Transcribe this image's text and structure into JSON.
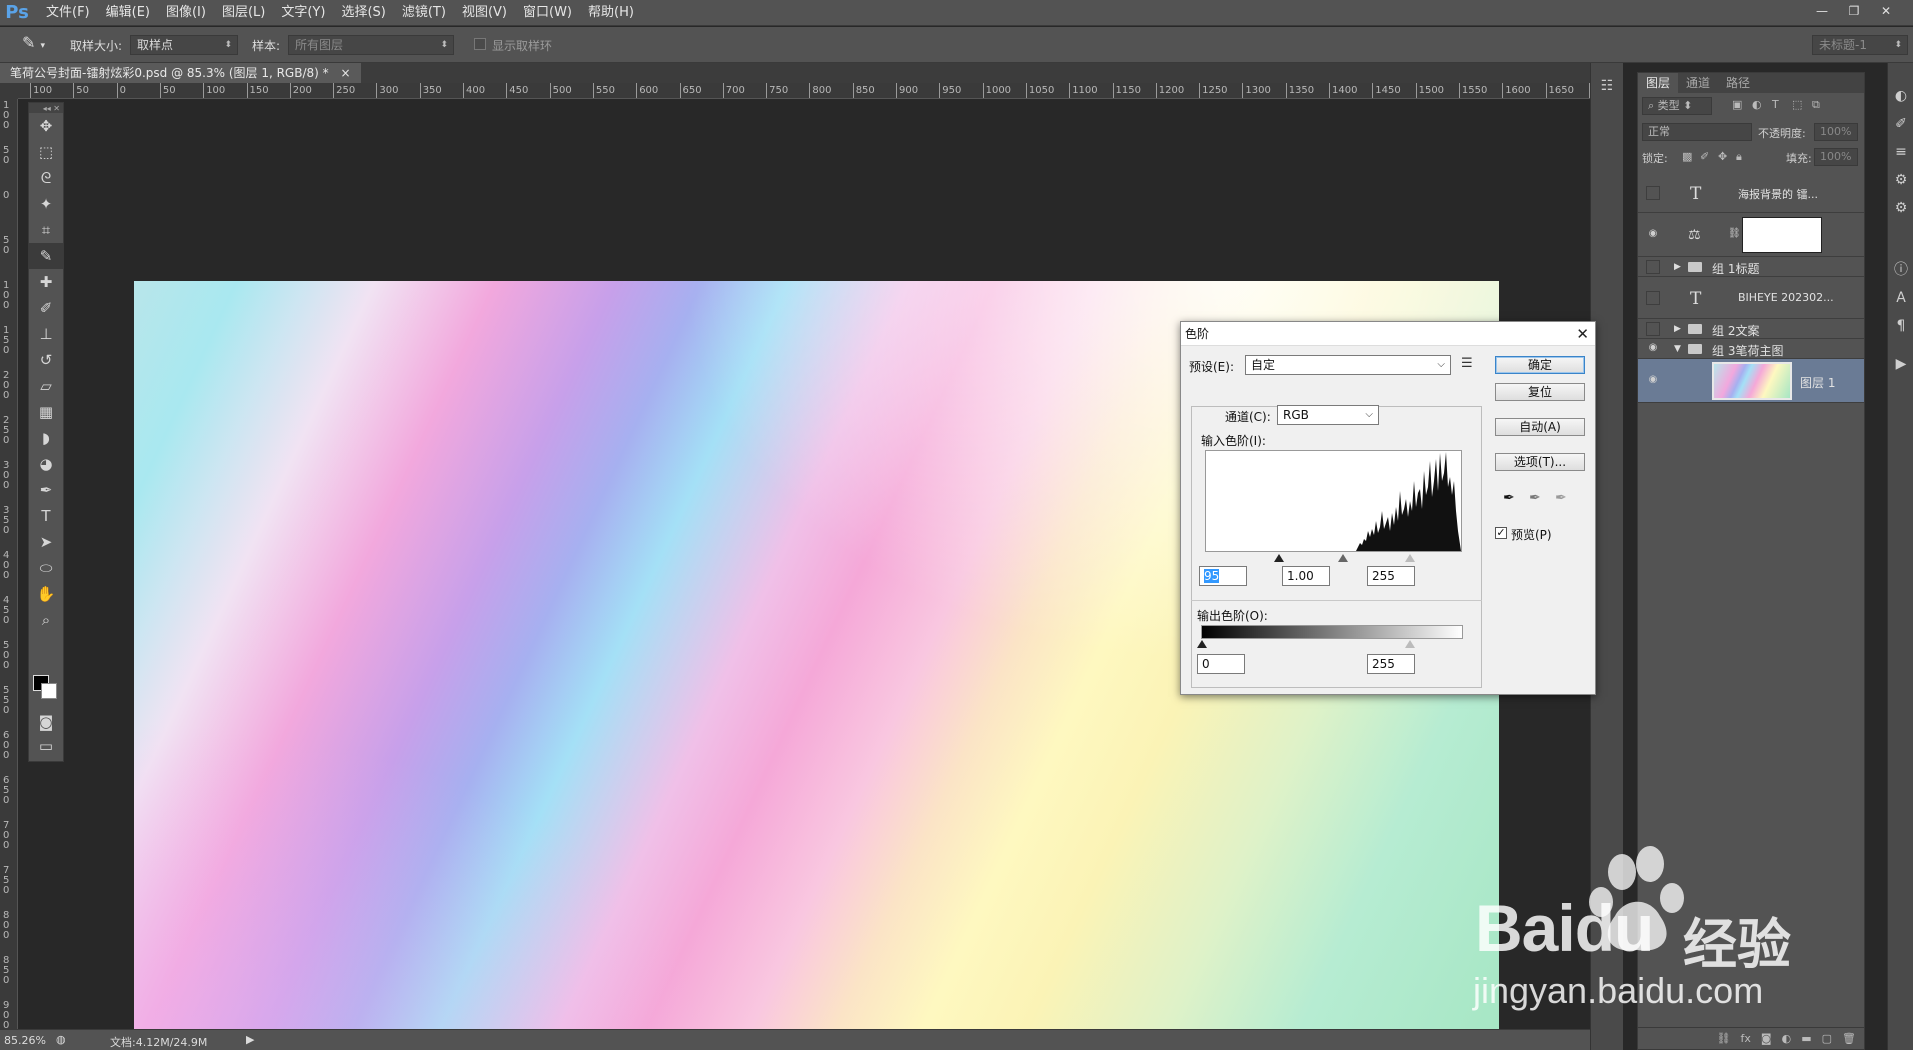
{
  "app": {
    "logo": "Ps"
  },
  "menu": [
    "文件(F)",
    "编辑(E)",
    "图像(I)",
    "图层(L)",
    "文字(Y)",
    "选择(S)",
    "滤镜(T)",
    "视图(V)",
    "窗口(W)",
    "帮助(H)"
  ],
  "window_controls": {
    "minimize": "—",
    "restore": "❐",
    "close": "✕"
  },
  "options_bar": {
    "sample_size_label": "取样大小:",
    "sample_size_value": "取样点",
    "sample_label": "样本:",
    "sample_value": "所有图层",
    "show_ring_label": "显示取样环",
    "workspace_value": "未标题-1"
  },
  "document_tab": {
    "title": "笔荷公号封面-镭射炫彩0.psd @ 85.3% (图层 1, RGB/8) *",
    "close": "×"
  },
  "ruler_h_labels": [
    "100",
    "50",
    "0",
    "50",
    "100",
    "150",
    "200",
    "250",
    "300",
    "350",
    "400",
    "450",
    "500",
    "550",
    "600",
    "650",
    "700",
    "750",
    "800",
    "850",
    "900",
    "950",
    "1000",
    "1050",
    "1100",
    "1150",
    "1200",
    "1250",
    "1300",
    "1350",
    "1400",
    "1450",
    "1500",
    "1550",
    "1600",
    "1650",
    "17"
  ],
  "ruler_v_labels": [
    "1 0 0",
    "5 0",
    "0",
    "5 0",
    "1 0 0",
    "1 5 0",
    "2 0 0",
    "2 5 0",
    "3 0 0",
    "3 5 0",
    "4 0 0",
    "4 5 0",
    "5 0 0",
    "5 5 0",
    "6 0 0",
    "6 5 0",
    "7 0 0",
    "7 5 0",
    "8 0 0",
    "8 5 0",
    "9 0 0"
  ],
  "tools": [
    {
      "name": "move-tool",
      "glyph": "✥"
    },
    {
      "name": "marquee-tool",
      "glyph": "⬚"
    },
    {
      "name": "lasso-tool",
      "glyph": "ᘓ"
    },
    {
      "name": "magic-wand-tool",
      "glyph": "✦"
    },
    {
      "name": "crop-tool",
      "glyph": "⌗"
    },
    {
      "name": "eyedropper-tool",
      "glyph": "✎"
    },
    {
      "name": "healing-tool",
      "glyph": "✚"
    },
    {
      "name": "brush-tool",
      "glyph": "✐"
    },
    {
      "name": "stamp-tool",
      "glyph": "⊥"
    },
    {
      "name": "history-brush-tool",
      "glyph": "↺"
    },
    {
      "name": "eraser-tool",
      "glyph": "▱"
    },
    {
      "name": "gradient-tool",
      "glyph": "▦"
    },
    {
      "name": "blur-tool",
      "glyph": "◗"
    },
    {
      "name": "dodge-tool",
      "glyph": "◕"
    },
    {
      "name": "pen-tool",
      "glyph": "✒"
    },
    {
      "name": "type-tool",
      "glyph": "T"
    },
    {
      "name": "path-select-tool",
      "glyph": "➤"
    },
    {
      "name": "ellipse-tool",
      "glyph": "⬭"
    },
    {
      "name": "hand-tool",
      "glyph": "✋"
    },
    {
      "name": "zoom-tool",
      "glyph": "⌕"
    }
  ],
  "layers_panel": {
    "tabs": [
      "图层",
      "通道",
      "路径"
    ],
    "filter_value": "类型",
    "blend_mode": "正常",
    "opacity_label": "不透明度:",
    "opacity_value": "100%",
    "lock_label": "锁定:",
    "fill_label": "填充:",
    "fill_value": "100%",
    "layers": [
      {
        "name": "海报背景的 镭...",
        "kind": "text",
        "visible": false
      },
      {
        "name": "",
        "kind": "adjustment",
        "visible": true
      },
      {
        "name": "组 1标题",
        "kind": "group",
        "visible": false
      },
      {
        "name": "BIHEYE 202302...",
        "kind": "text",
        "visible": false
      },
      {
        "name": "组 2文案",
        "kind": "group",
        "visible": false
      },
      {
        "name": "组 3笔荷主图",
        "kind": "group-open",
        "visible": true
      },
      {
        "name": "图层 1",
        "kind": "pixel",
        "visible": true,
        "selected": true
      }
    ]
  },
  "status": {
    "zoom": "85.26%",
    "doc_info": "文档:4.12M/24.9M"
  },
  "levels_dialog": {
    "title": "色阶",
    "preset_label": "预设(E):",
    "preset_value": "自定",
    "channel_label": "通道(C):",
    "channel_value": "RGB",
    "input_label": "输入色阶(I):",
    "input_black": "95",
    "input_gamma": "1.00",
    "input_white": "255",
    "output_label": "输出色阶(O):",
    "output_black": "0",
    "output_white": "255",
    "ok": "确定",
    "reset": "复位",
    "auto": "自动(A)",
    "options": "选项(T)...",
    "preview_label": "预览(P)",
    "preview_checked": true
  },
  "watermark": {
    "brand": "Baidu",
    "cn": "经验",
    "url": "jingyan.baidu.com"
  }
}
